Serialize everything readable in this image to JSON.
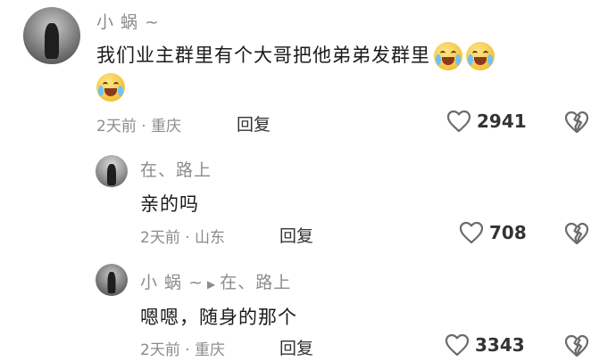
{
  "comments": [
    {
      "author": "小 蜗 ~",
      "text_line1": "我们业主群里有个大哥把他弟弟发群里",
      "meta": "2天前 · 重庆",
      "reply_label": "回复",
      "likes": "2941",
      "emojis": [
        "crying-laughing-emoji",
        "crying-laughing-emoji",
        "crying-laughing-emoji"
      ]
    },
    {
      "author": "在、路上",
      "text": "亲的吗",
      "meta": "2天前 · 山东",
      "reply_label": "回复",
      "likes": "708"
    },
    {
      "author": "小 蜗 ~",
      "reply_to": "在、路上",
      "text": "嗯嗯，随身的那个",
      "meta": "2天前 · 重庆",
      "reply_label": "回复",
      "likes": "3343"
    }
  ],
  "colors": {
    "secondary_text": "#8c8c8c",
    "primary_text": "#1a1a1a",
    "icon_stroke": "#6b6b6b"
  }
}
